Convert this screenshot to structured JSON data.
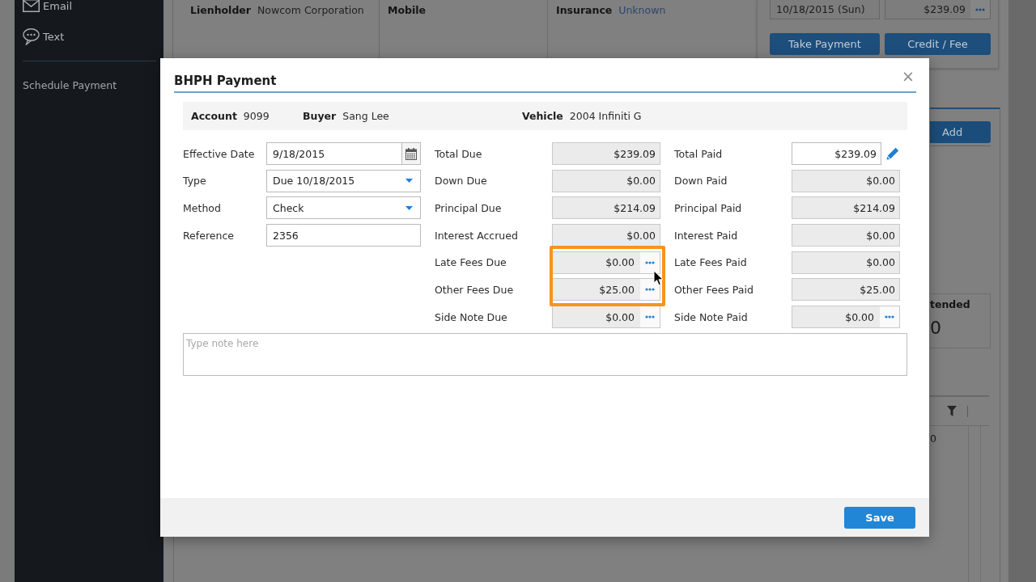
{
  "sidebar": {
    "channels": [
      {
        "label": "Email"
      },
      {
        "label": "Text"
      }
    ],
    "links": [
      {
        "label": "Schedule Payment"
      }
    ]
  },
  "account": {
    "details": [
      {
        "label": "Lienholder",
        "value": "Nowcom Corporation",
        "kind": "text"
      },
      {
        "label": "Mobile"
      },
      {
        "label": "Insurance",
        "value": "Unknown",
        "kind": "link"
      }
    ],
    "schedule": {
      "date": "10/18/2015 (Sun)",
      "amount": "$239.09",
      "buttons": [
        "Take Payment",
        "Credit / Fee"
      ]
    },
    "add_button": "Add",
    "summary": {
      "label": "tended",
      "value": "0"
    },
    "grid": {
      "cells": [
        "0"
      ]
    }
  },
  "dialog": {
    "title": "BHPH Payment",
    "close": "×",
    "info": [
      {
        "label": "Account",
        "value": "9099"
      },
      {
        "label": "Buyer",
        "value": "Sang Lee"
      },
      {
        "label": "Vehicle",
        "value": "2004 Infiniti G"
      }
    ],
    "fields": [
      {
        "label": "Effective Date",
        "value": "9/18/2015",
        "kind": "date"
      },
      {
        "label": "Type",
        "value": "Due 10/18/2015",
        "kind": "select"
      },
      {
        "label": "Method",
        "value": "Check",
        "kind": "select"
      },
      {
        "label": "Reference",
        "value": "2356",
        "kind": "text"
      }
    ],
    "due": [
      {
        "label": "Total Due",
        "value": "$239.09",
        "more": false,
        "highlighted": false
      },
      {
        "label": "Down Due",
        "value": "$0.00",
        "more": false,
        "highlighted": false
      },
      {
        "label": "Principal Due",
        "value": "$214.09",
        "more": false,
        "highlighted": false
      },
      {
        "label": "Interest Accrued",
        "value": "$0.00",
        "more": false,
        "highlighted": false
      },
      {
        "label": "Late Fees Due",
        "value": "$0.00",
        "more": true,
        "highlighted": true
      },
      {
        "label": "Other Fees Due",
        "value": "$25.00",
        "more": true,
        "highlighted": true
      },
      {
        "label": "Side Note Due",
        "value": "$0.00",
        "more": true,
        "highlighted": false
      }
    ],
    "paid": [
      {
        "label": "Total Paid",
        "value": "$239.09",
        "more": false,
        "editable": true
      },
      {
        "label": "Down Paid",
        "value": "$0.00",
        "more": false,
        "editable": false
      },
      {
        "label": "Principal Paid",
        "value": "$214.09",
        "more": false,
        "editable": false
      },
      {
        "label": "Interest Paid",
        "value": "$0.00",
        "more": false,
        "editable": false
      },
      {
        "label": "Late Fees Paid",
        "value": "$0.00",
        "more": false,
        "editable": false
      },
      {
        "label": "Other Fees Paid",
        "value": "$25.00",
        "more": false,
        "editable": false
      },
      {
        "label": "Side Note Paid",
        "value": "$0.00",
        "more": true,
        "editable": false
      }
    ],
    "note": {
      "placeholder": "Type note here"
    },
    "save": "Save"
  }
}
